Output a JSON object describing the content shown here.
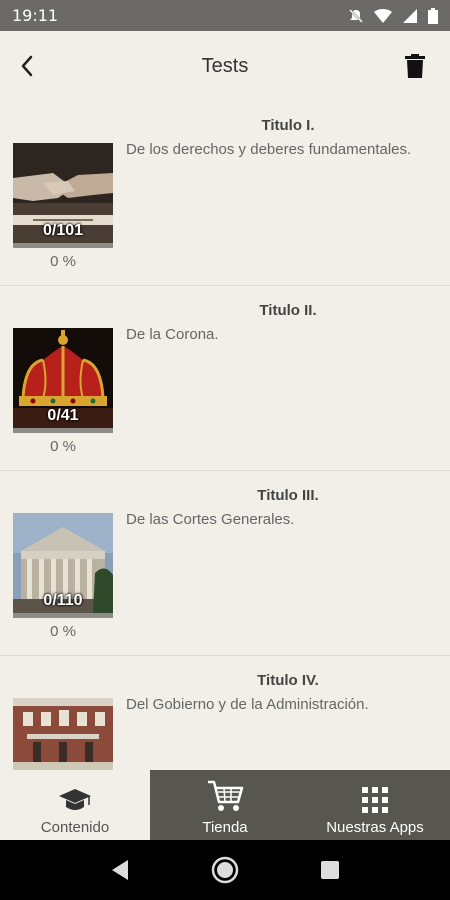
{
  "status": {
    "time": "19:11"
  },
  "header": {
    "title": "Tests"
  },
  "items": [
    {
      "title": "Titulo I.",
      "description": "De los derechos y deberes fundamentales.",
      "count": "0/101",
      "percent": "0 %"
    },
    {
      "title": "Titulo II.",
      "description": "De la Corona.",
      "count": "0/41",
      "percent": "0 %"
    },
    {
      "title": "Titulo III.",
      "description": "De las Cortes Generales.",
      "count": "0/110",
      "percent": "0 %"
    },
    {
      "title": "Titulo IV.",
      "description": "Del Gobierno y de la Administración.",
      "count": "",
      "percent": ""
    }
  ],
  "bottom_nav": [
    {
      "label": "Contenido",
      "icon": "graduation-cap-icon"
    },
    {
      "label": "Tienda",
      "icon": "cart-icon"
    },
    {
      "label": "Nuestras Apps",
      "icon": "grid-icon"
    }
  ],
  "colors": {
    "background": "#f2efe8",
    "nav_dark": "#58574f",
    "status_bar": "#6b6a66"
  }
}
